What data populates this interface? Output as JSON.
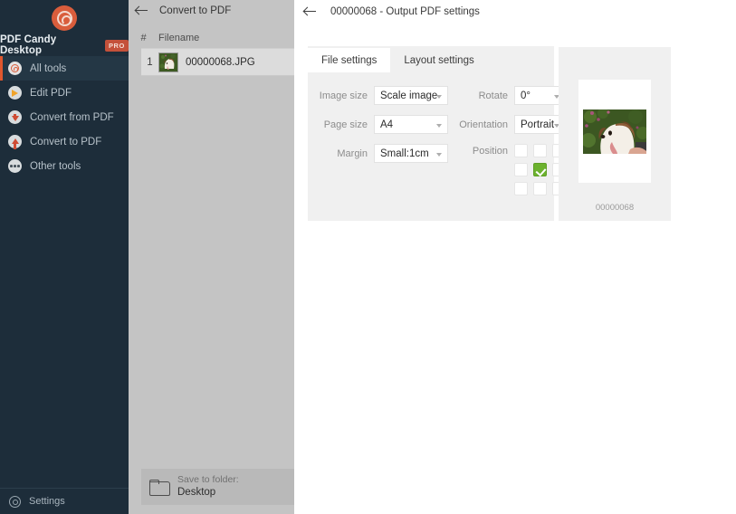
{
  "sidebar": {
    "brand": "PDF Candy Desktop",
    "pro_badge": "PRO",
    "logo_icon": "spiral-lollipop-icon",
    "items": [
      {
        "label": "All tools",
        "icon": "spiral-icon",
        "active": true
      },
      {
        "label": "Edit PDF",
        "icon": "pencil-icon",
        "active": false
      },
      {
        "label": "Convert from PDF",
        "icon": "arrow-down-icon",
        "active": false
      },
      {
        "label": "Convert to PDF",
        "icon": "arrow-up-icon",
        "active": false
      },
      {
        "label": "Other tools",
        "icon": "ellipsis-icon",
        "active": false
      }
    ],
    "settings_label": "Settings",
    "settings_icon": "gear-icon",
    "bg_color": "#1d2d3a",
    "accent_color": "#e0572e"
  },
  "file_panel": {
    "back_icon": "back-arrow-icon",
    "title": "Convert to PDF",
    "columns": {
      "number": "#",
      "filename": "Filename"
    },
    "rows": [
      {
        "number": "1",
        "filename": "00000068.JPG",
        "thumb": "dog-thumbnail"
      }
    ],
    "save_bar": {
      "folder_icon": "folder-icon",
      "label": "Save to folder:",
      "value": "Desktop"
    }
  },
  "main": {
    "back_icon": "back-arrow-icon",
    "title": "00000068 - Output PDF settings",
    "tabs": [
      {
        "label": "File settings",
        "active": true
      },
      {
        "label": "Layout settings",
        "active": false
      }
    ],
    "fields": {
      "image_size": {
        "label": "Image size",
        "value": "Scale image"
      },
      "page_size": {
        "label": "Page size",
        "value": "A4"
      },
      "margin": {
        "label": "Margin",
        "value": "Small:1cm"
      },
      "rotate": {
        "label": "Rotate",
        "value": "0°"
      },
      "orientation": {
        "label": "Orientation",
        "value": "Portrait"
      },
      "position": {
        "label": "Position",
        "selected_index": 4,
        "cells": [
          0,
          1,
          2,
          3,
          4,
          5,
          6,
          7,
          8
        ],
        "selected_color": "#6cb22e"
      }
    },
    "preview": {
      "caption": "00000068",
      "image_alt": "dog-preview-image"
    }
  }
}
